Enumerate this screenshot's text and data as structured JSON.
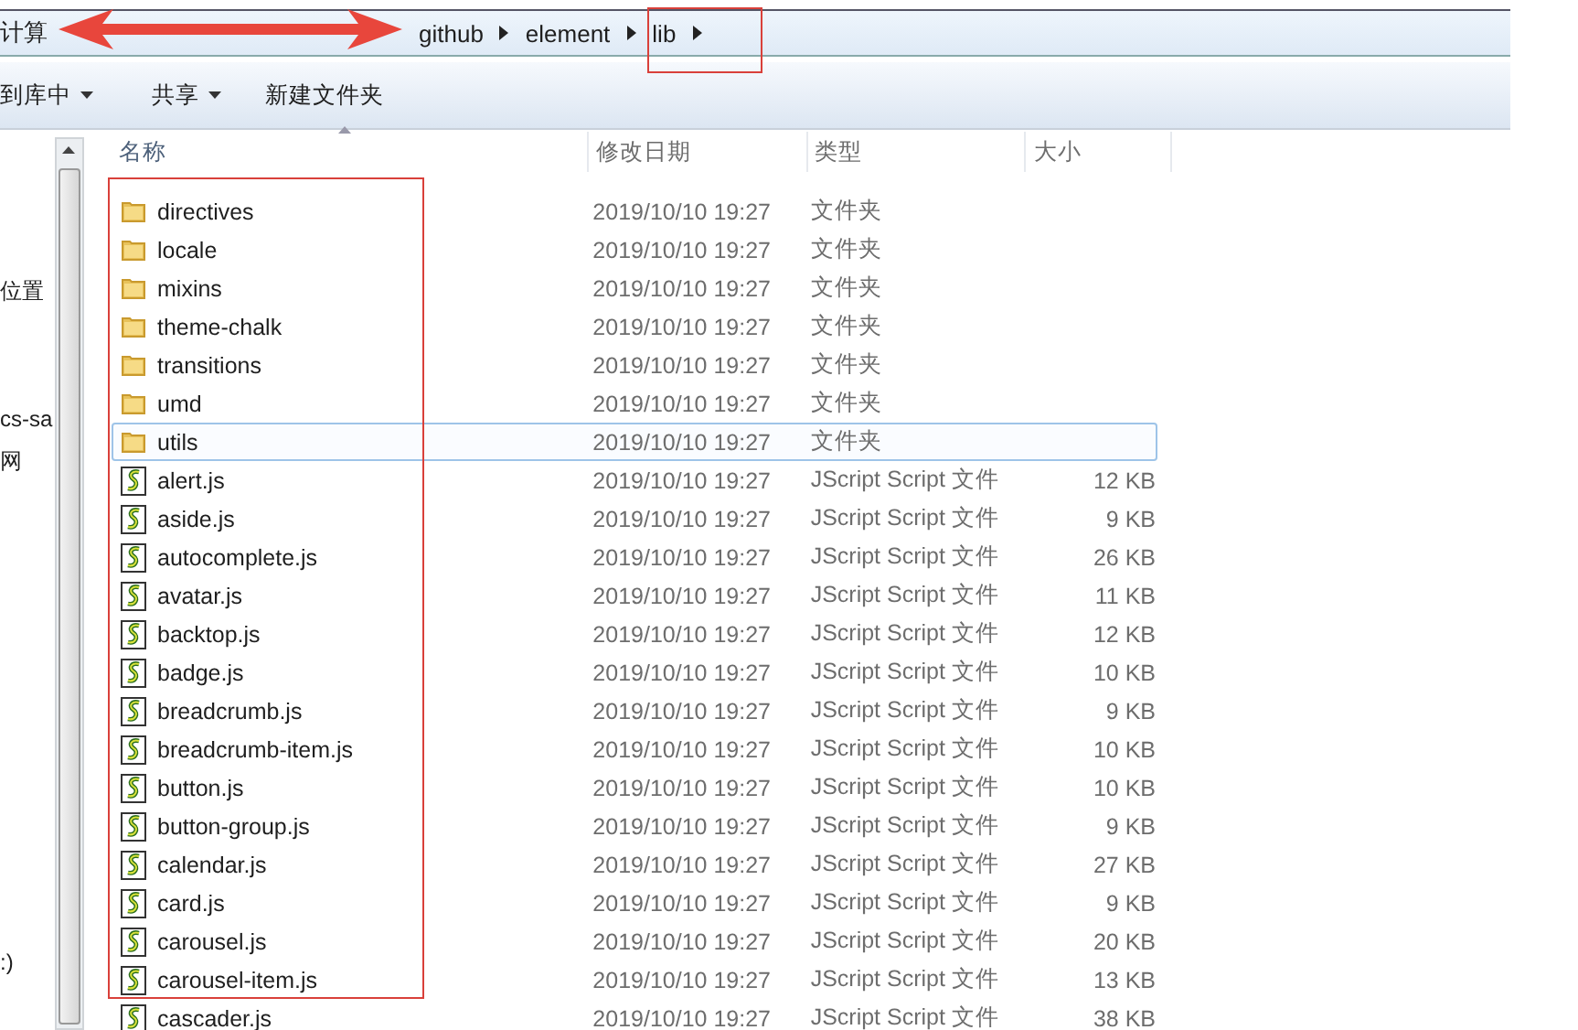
{
  "address_bar": {
    "segments": [
      {
        "label": "计算"
      },
      {
        "label": "github"
      },
      {
        "label": "element"
      },
      {
        "label": "lib"
      }
    ]
  },
  "toolbar": {
    "buttons": [
      {
        "label": "到库中",
        "dropdown": true
      },
      {
        "label": "共享",
        "dropdown": true
      },
      {
        "label": "新建文件夹",
        "dropdown": false
      }
    ]
  },
  "nav_pane": {
    "items": [
      "位置",
      "cs-sa",
      "网",
      ":)"
    ]
  },
  "table": {
    "columns": [
      "名称",
      "修改日期",
      "类型",
      "大小"
    ],
    "rows": [
      {
        "kind": "folder",
        "name": "directives",
        "date": "2019/10/10 19:27",
        "type": "文件夹",
        "size": "",
        "selected": false
      },
      {
        "kind": "folder",
        "name": "locale",
        "date": "2019/10/10 19:27",
        "type": "文件夹",
        "size": "",
        "selected": false
      },
      {
        "kind": "folder",
        "name": "mixins",
        "date": "2019/10/10 19:27",
        "type": "文件夹",
        "size": "",
        "selected": false
      },
      {
        "kind": "folder",
        "name": "theme-chalk",
        "date": "2019/10/10 19:27",
        "type": "文件夹",
        "size": "",
        "selected": false
      },
      {
        "kind": "folder",
        "name": "transitions",
        "date": "2019/10/10 19:27",
        "type": "文件夹",
        "size": "",
        "selected": false
      },
      {
        "kind": "folder",
        "name": "umd",
        "date": "2019/10/10 19:27",
        "type": "文件夹",
        "size": "",
        "selected": false
      },
      {
        "kind": "folder",
        "name": "utils",
        "date": "2019/10/10 19:27",
        "type": "文件夹",
        "size": "",
        "selected": true
      },
      {
        "kind": "script",
        "name": "alert.js",
        "date": "2019/10/10 19:27",
        "type": "JScript Script 文件",
        "size": "12 KB",
        "selected": false
      },
      {
        "kind": "script",
        "name": "aside.js",
        "date": "2019/10/10 19:27",
        "type": "JScript Script 文件",
        "size": "9 KB",
        "selected": false
      },
      {
        "kind": "script",
        "name": "autocomplete.js",
        "date": "2019/10/10 19:27",
        "type": "JScript Script 文件",
        "size": "26 KB",
        "selected": false
      },
      {
        "kind": "script",
        "name": "avatar.js",
        "date": "2019/10/10 19:27",
        "type": "JScript Script 文件",
        "size": "11 KB",
        "selected": false
      },
      {
        "kind": "script",
        "name": "backtop.js",
        "date": "2019/10/10 19:27",
        "type": "JScript Script 文件",
        "size": "12 KB",
        "selected": false
      },
      {
        "kind": "script",
        "name": "badge.js",
        "date": "2019/10/10 19:27",
        "type": "JScript Script 文件",
        "size": "10 KB",
        "selected": false
      },
      {
        "kind": "script",
        "name": "breadcrumb.js",
        "date": "2019/10/10 19:27",
        "type": "JScript Script 文件",
        "size": "9 KB",
        "selected": false
      },
      {
        "kind": "script",
        "name": "breadcrumb-item.js",
        "date": "2019/10/10 19:27",
        "type": "JScript Script 文件",
        "size": "10 KB",
        "selected": false
      },
      {
        "kind": "script",
        "name": "button.js",
        "date": "2019/10/10 19:27",
        "type": "JScript Script 文件",
        "size": "10 KB",
        "selected": false
      },
      {
        "kind": "script",
        "name": "button-group.js",
        "date": "2019/10/10 19:27",
        "type": "JScript Script 文件",
        "size": "9 KB",
        "selected": false
      },
      {
        "kind": "script",
        "name": "calendar.js",
        "date": "2019/10/10 19:27",
        "type": "JScript Script 文件",
        "size": "27 KB",
        "selected": false
      },
      {
        "kind": "script",
        "name": "card.js",
        "date": "2019/10/10 19:27",
        "type": "JScript Script 文件",
        "size": "9 KB",
        "selected": false
      },
      {
        "kind": "script",
        "name": "carousel.js",
        "date": "2019/10/10 19:27",
        "type": "JScript Script 文件",
        "size": "20 KB",
        "selected": false
      },
      {
        "kind": "script",
        "name": "carousel-item.js",
        "date": "2019/10/10 19:27",
        "type": "JScript Script 文件",
        "size": "13 KB",
        "selected": false
      },
      {
        "kind": "script",
        "name": "cascader.js",
        "date": "2019/10/10 19:27",
        "type": "JScript Script 文件",
        "size": "38 KB",
        "selected": false
      }
    ]
  }
}
